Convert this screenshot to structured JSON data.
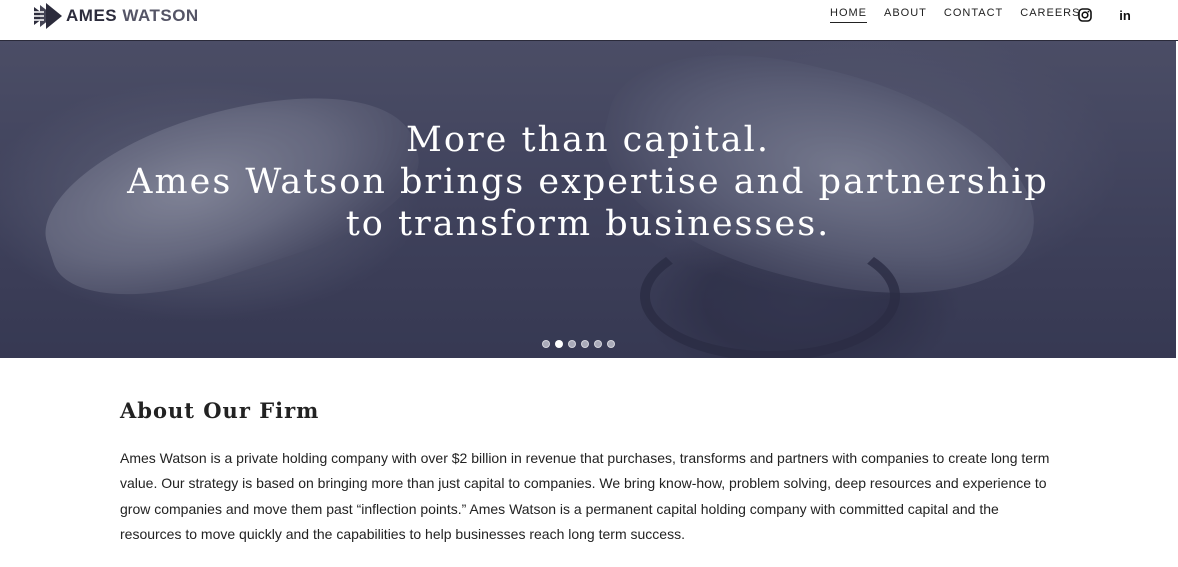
{
  "header": {
    "brand": {
      "name_part1": "AMES",
      "name_part2": "WATSON"
    },
    "nav": [
      {
        "label": "HOME",
        "active": true
      },
      {
        "label": "ABOUT",
        "active": false
      },
      {
        "label": "CONTACT",
        "active": false
      },
      {
        "label": "CAREERS",
        "active": false
      }
    ],
    "social": [
      {
        "icon": "instagram-icon"
      },
      {
        "icon": "linkedin-icon",
        "glyph": "in"
      }
    ]
  },
  "hero": {
    "lines": [
      "More than capital.",
      "Ames Watson brings expertise and partnership",
      "to transform businesses."
    ],
    "carousel": {
      "slide_count": 6,
      "active_index": 1
    }
  },
  "about": {
    "title": "About Our Firm",
    "body": "Ames Watson is a private holding company with over $2 billion in revenue that purchases, transforms and partners with companies to create long term value. Our strategy is based on bringing more than just capital to companies.  We bring know-how, problem solving, deep resources and experience to grow companies and move them past “inflection points.”  Ames Watson is a permanent capital holding company with committed capital and the resources to move quickly and the capabilities to help businesses reach long term success."
  },
  "colors": {
    "brand_dark": "#2c2c3c",
    "hero_tint": "#4a4c66",
    "text": "#222222"
  }
}
